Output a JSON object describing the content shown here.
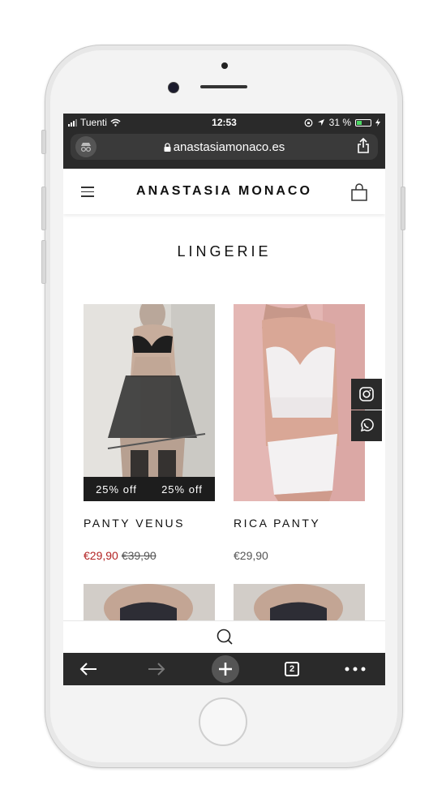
{
  "status": {
    "carrier": "Tuenti",
    "time": "12:53",
    "battery": "31 %"
  },
  "browser": {
    "url": "anastasiamonaco.es"
  },
  "site": {
    "brand": "ANASTASIA MONACO",
    "page_title": "LINGERIE"
  },
  "products": [
    {
      "name": "PANTY VENUS",
      "price": "€29,90",
      "old_price": "€39,90",
      "badges": [
        "25% off",
        "25% off"
      ]
    },
    {
      "name": "RICA PANTY",
      "price": "€29,90"
    }
  ],
  "toolbar": {
    "tab_count": "2"
  },
  "colors": {
    "sale": "#b22222",
    "dark": "#2a2a2a",
    "badge": "#1d1d1d"
  }
}
